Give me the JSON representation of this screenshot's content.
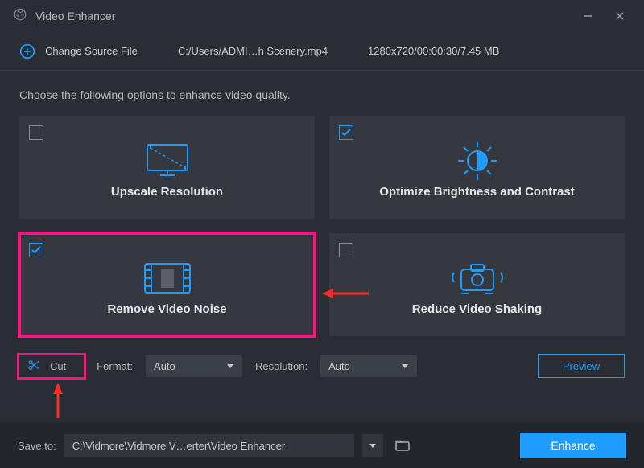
{
  "app": {
    "title": "Video Enhancer"
  },
  "toolbar": {
    "change_source_label": "Change Source File",
    "file_path": "C:/Users/ADMI…h Scenery.mp4",
    "file_meta": "1280x720/00:00:30/7.45 MB"
  },
  "instruction": "Choose the following options to enhance video quality.",
  "cards": {
    "upscale": {
      "label": "Upscale Resolution",
      "checked": false
    },
    "brightness": {
      "label": "Optimize Brightness and Contrast",
      "checked": true
    },
    "denoise": {
      "label": "Remove Video Noise",
      "checked": true
    },
    "shaking": {
      "label": "Reduce Video Shaking",
      "checked": false
    }
  },
  "controls": {
    "cut_label": "Cut",
    "format_label": "Format:",
    "format_value": "Auto",
    "resolution_label": "Resolution:",
    "resolution_value": "Auto",
    "preview_label": "Preview"
  },
  "bottom": {
    "save_to_label": "Save to:",
    "path": "C:\\Vidmore\\Vidmore V…erter\\Video Enhancer",
    "enhance_label": "Enhance"
  }
}
